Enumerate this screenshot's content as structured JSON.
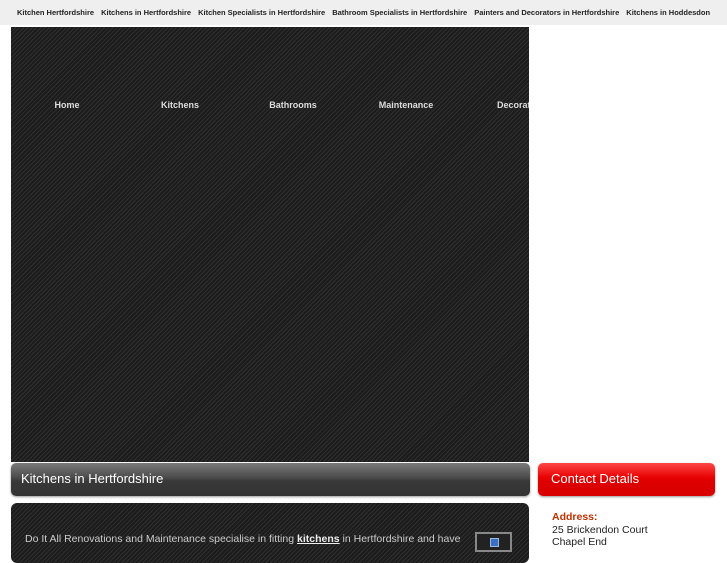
{
  "top_links": [
    "Kitchen Hertfordshire",
    "Kitchens in Hertfordshire",
    "Kitchen Specialists in Hertfordshire",
    "Bathroom Specialists in Hertfordshire",
    "Painters and Decorators in Hertfordshire",
    "Kitchens in Hoddesdon"
  ],
  "nav": [
    "Home",
    "Kitchens",
    "Bathrooms",
    "Maintenance",
    "Decorating"
  ],
  "main_heading": "Kitchens in Hertfordshire",
  "sidebar_heading": "Contact Details",
  "content": {
    "before": "Do It All Renovations and Maintenance specialise in fitting ",
    "link": "kitchens",
    "after": " in Hertfordshire and have"
  },
  "contact": {
    "address_label": "Address:",
    "line1": "25 Brickendon Court",
    "line2": "Chapel End"
  }
}
